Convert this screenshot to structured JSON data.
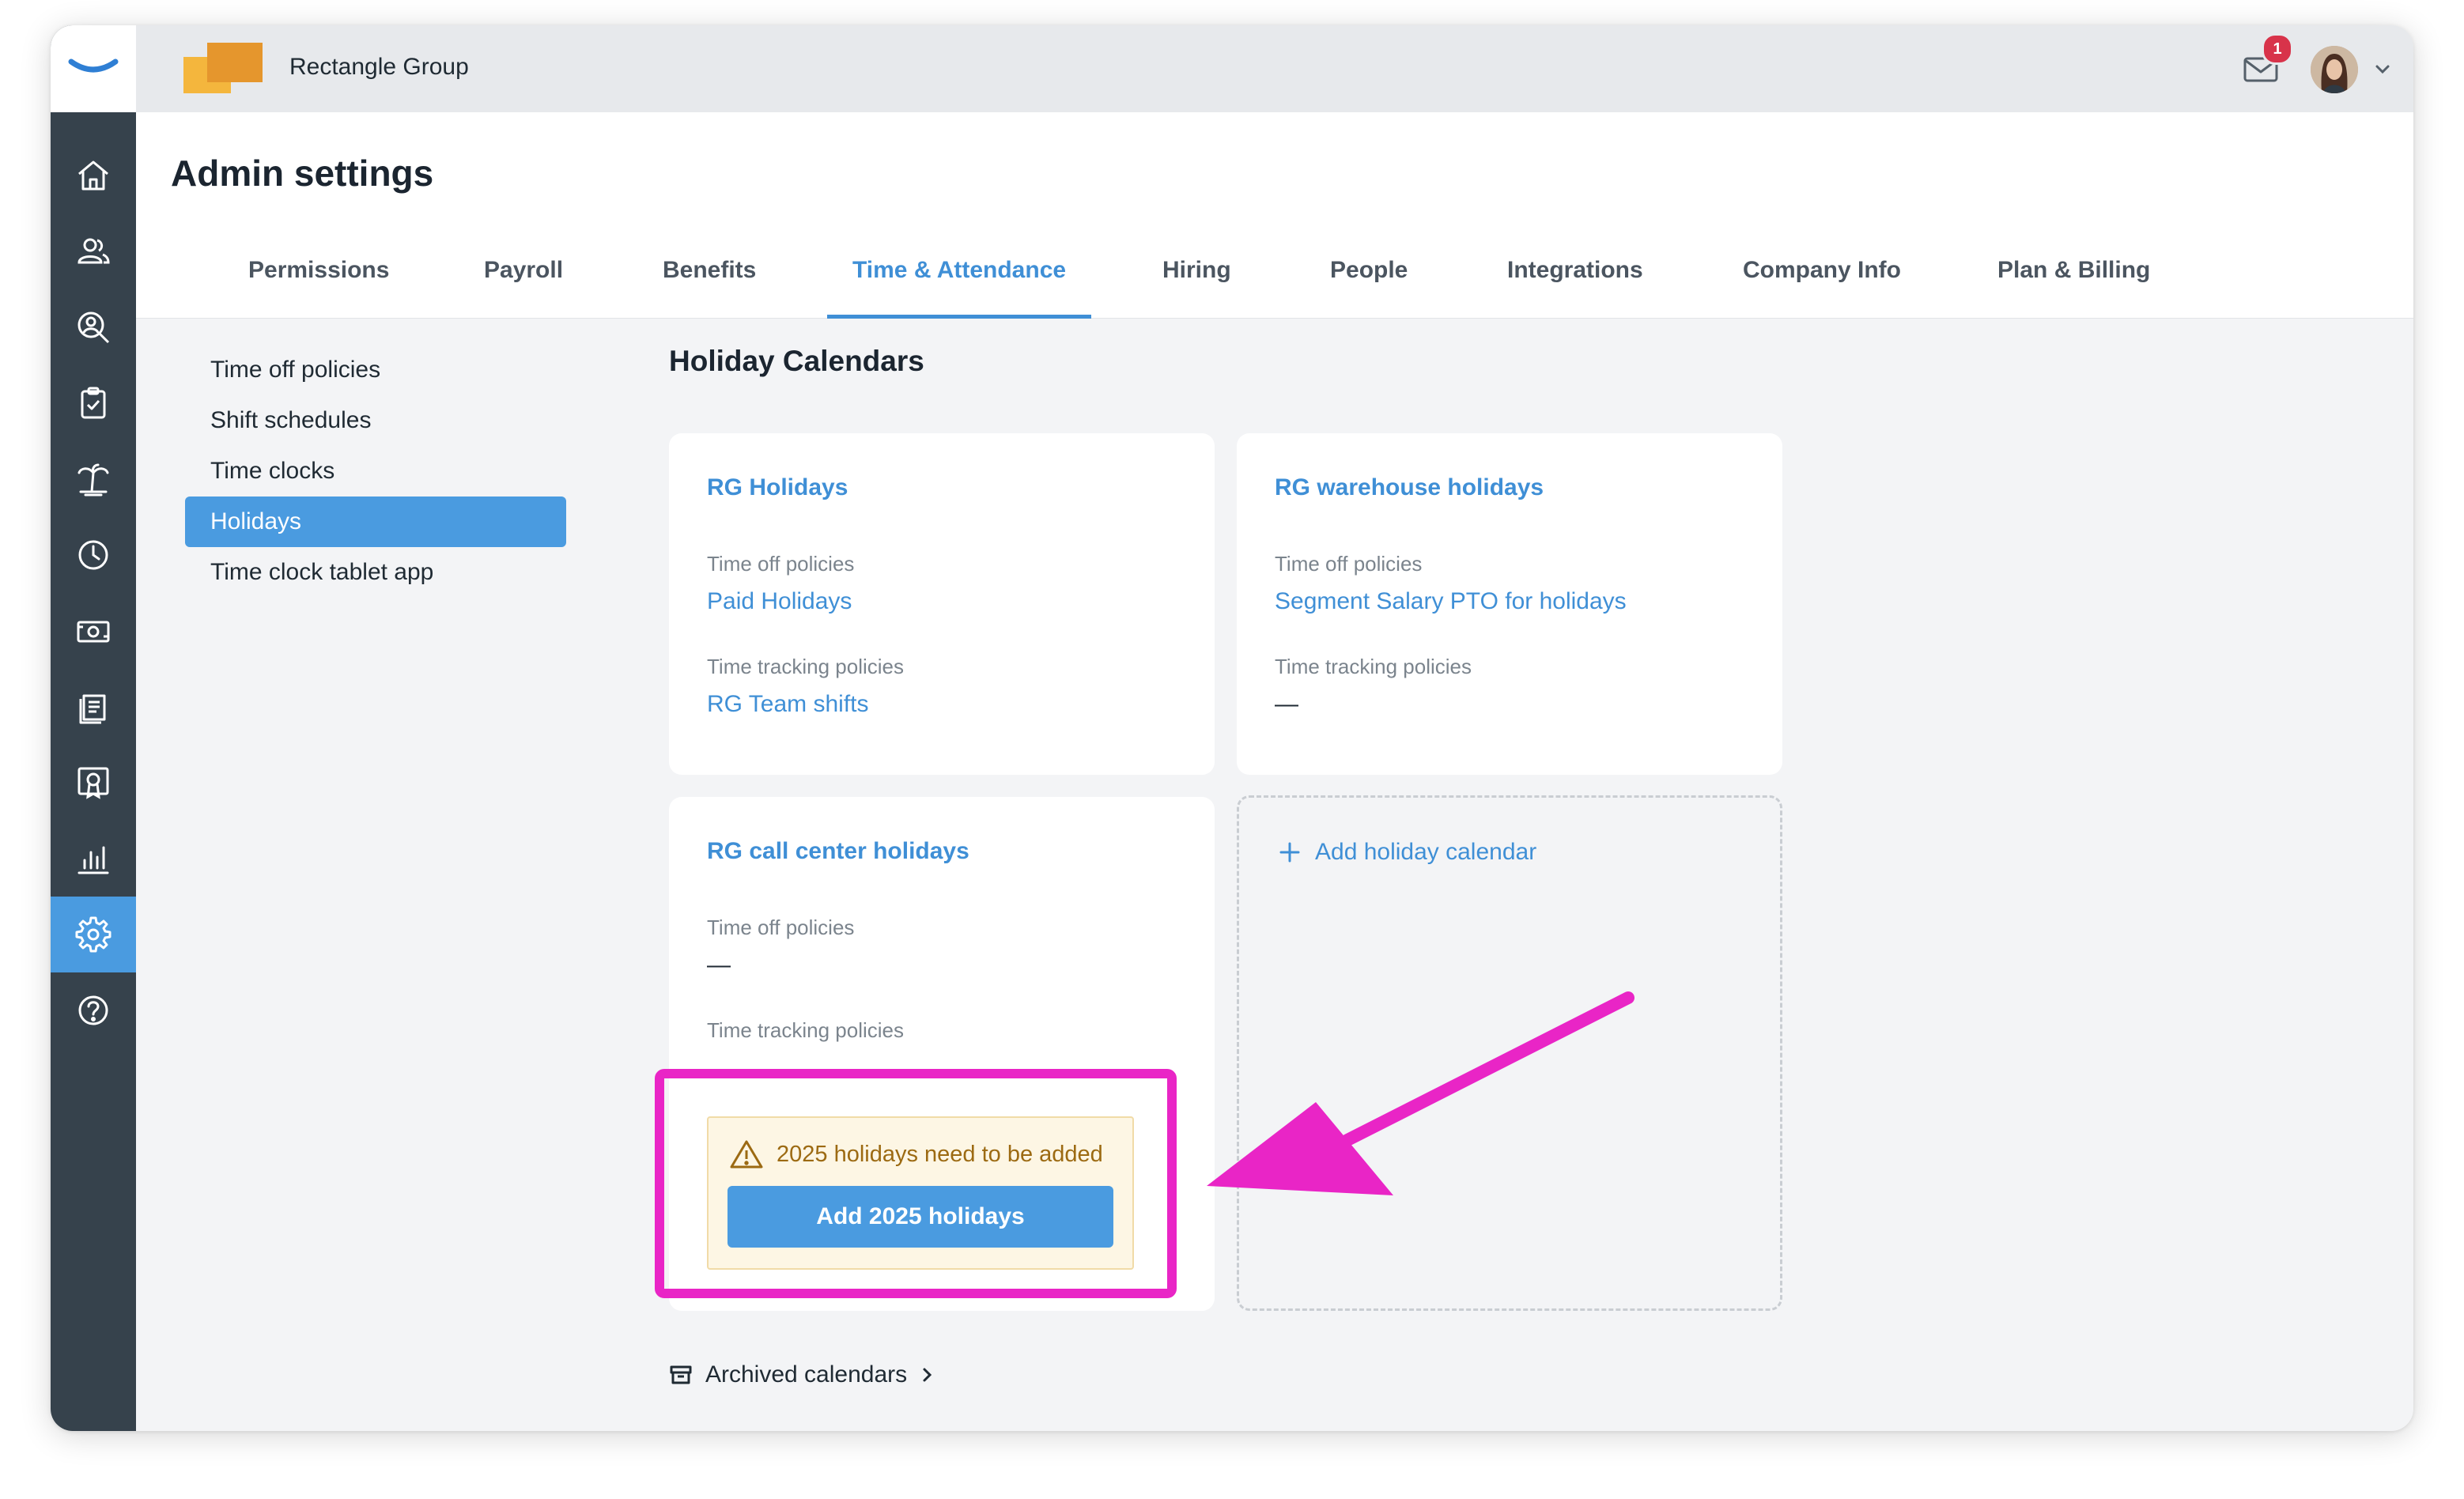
{
  "app": {
    "company_name": "Rectangle Group",
    "notification_count": "1"
  },
  "sidebar": {
    "items": [
      {
        "icon": "home-icon",
        "active": false
      },
      {
        "icon": "people-icon",
        "active": false
      },
      {
        "icon": "search-person-icon",
        "active": false
      },
      {
        "icon": "clipboard-check-icon",
        "active": false
      },
      {
        "icon": "palm-tree-icon",
        "active": false
      },
      {
        "icon": "clock-icon",
        "active": false
      },
      {
        "icon": "money-icon",
        "active": false
      },
      {
        "icon": "documents-icon",
        "active": false
      },
      {
        "icon": "certificate-icon",
        "active": false
      },
      {
        "icon": "chart-icon",
        "active": false
      },
      {
        "icon": "gear-icon",
        "active": true
      },
      {
        "icon": "help-icon",
        "active": false
      }
    ]
  },
  "header": {
    "title": "Admin settings",
    "tabs": [
      {
        "label": "Permissions",
        "active": false
      },
      {
        "label": "Payroll",
        "active": false
      },
      {
        "label": "Benefits",
        "active": false
      },
      {
        "label": "Time & Attendance",
        "active": true
      },
      {
        "label": "Hiring",
        "active": false
      },
      {
        "label": "People",
        "active": false
      },
      {
        "label": "Integrations",
        "active": false
      },
      {
        "label": "Company Info",
        "active": false
      },
      {
        "label": "Plan & Billing",
        "active": false
      }
    ]
  },
  "menu": {
    "items": [
      {
        "label": "Time off policies",
        "active": false
      },
      {
        "label": "Shift schedules",
        "active": false
      },
      {
        "label": "Time clocks",
        "active": false
      },
      {
        "label": "Holidays",
        "active": true
      },
      {
        "label": "Time clock tablet app",
        "active": false
      }
    ]
  },
  "content": {
    "section_title": "Holiday Calendars",
    "cards": [
      {
        "title": "RG Holidays",
        "time_off_label": "Time off policies",
        "time_off_value": "Paid Holidays",
        "time_tracking_label": "Time tracking policies",
        "time_tracking_value": "RG Team shifts"
      },
      {
        "title": "RG warehouse holidays",
        "time_off_label": "Time off policies",
        "time_off_value": "Segment Salary PTO for holidays",
        "time_tracking_label": "Time tracking policies",
        "time_tracking_value": "—"
      },
      {
        "title": "RG call center holidays",
        "time_off_label": "Time off policies",
        "time_off_value": "—",
        "time_tracking_label": "Time tracking policies",
        "warning_text": "2025 holidays need to be added",
        "warning_button": "Add 2025 holidays"
      }
    ],
    "add_calendar_label": "Add holiday calendar",
    "archived_label": "Archived calendars"
  },
  "colors": {
    "accent": "#3f8fd6",
    "sidebar_bg": "#36424c",
    "highlight": "#e925c6",
    "warning_bg": "#fdf6e4"
  }
}
